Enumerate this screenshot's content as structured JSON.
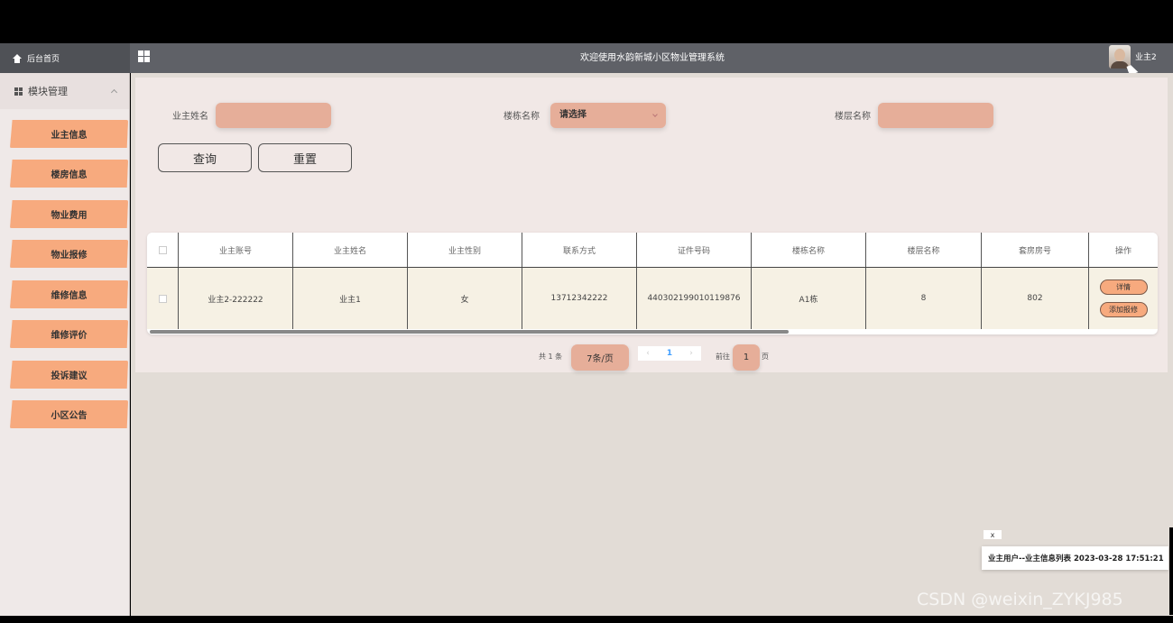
{
  "topbar": {
    "home_label": "后台首页",
    "system_title": "欢迎使用水韵新城小区物业管理系统",
    "username": "业主2"
  },
  "sidebar": {
    "module_title": "模块管理",
    "items": [
      "业主信息",
      "楼房信息",
      "物业费用",
      "物业报修",
      "维修信息",
      "维修评价",
      "投诉建议",
      "小区公告"
    ]
  },
  "filters": {
    "owner_name_label": "业主姓名",
    "owner_name_value": "",
    "building_label": "楼栋名称",
    "building_value": "请选择",
    "floor_label": "楼层名称",
    "floor_value": ""
  },
  "buttons": {
    "query": "查询",
    "reset": "重置"
  },
  "table": {
    "columns": [
      "业主账号",
      "业主姓名",
      "业主性别",
      "联系方式",
      "证件号码",
      "楼栋名称",
      "楼层名称",
      "套房房号",
      "操作"
    ],
    "rows": [
      {
        "account": "业主2-222222",
        "name": "业主1",
        "gender": "女",
        "phone": "13712342222",
        "id_number": "440302199010119876",
        "building": "A1栋",
        "floor": "8",
        "room": "802",
        "detail_btn": "详情",
        "repair_btn": "添加报修"
      }
    ]
  },
  "pagination": {
    "total": "共 1 条",
    "page_size": "7条/页",
    "prev": "‹",
    "current": "1",
    "next": "›",
    "goto_label": "前往",
    "goto_value": "1",
    "page_unit": "页"
  },
  "toast": {
    "close": "x",
    "message": "业主用户--业主信息列表 2023-03-28 17:51:21"
  },
  "watermark": "CSDN @weixin_ZYKJ985"
}
